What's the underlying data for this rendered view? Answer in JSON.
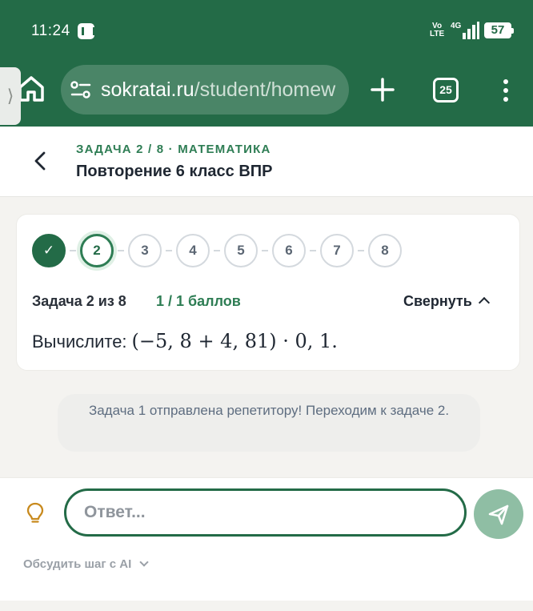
{
  "status_bar": {
    "time": "11:24",
    "volte": "Vo\nLTE",
    "network": "4G",
    "battery": "57"
  },
  "browser": {
    "url_domain": "sokratai.ru",
    "url_path": "/student/homew",
    "tab_count": "25"
  },
  "header": {
    "breadcrumb": "ЗАДАЧА 2 / 8 · МАТЕМАТИКА",
    "title": "Повторение 6 класс ВПР"
  },
  "task": {
    "steps": [
      {
        "label": "✓",
        "state": "done"
      },
      {
        "label": "2",
        "state": "current"
      },
      {
        "label": "3",
        "state": "pending"
      },
      {
        "label": "4",
        "state": "pending"
      },
      {
        "label": "5",
        "state": "pending"
      },
      {
        "label": "6",
        "state": "pending"
      },
      {
        "label": "7",
        "state": "pending"
      },
      {
        "label": "8",
        "state": "pending"
      }
    ],
    "label": "Задача 2 из 8",
    "score": "1 / 1 баллов",
    "collapse_label": "Свернуть",
    "question_prefix": "Вычислите:",
    "question_expr": "(−5, 8 + 4, 81) · 0, 1."
  },
  "info_message": "Задача 1 отправлена репетитору! Переходим к задаче 2.",
  "answer": {
    "placeholder": "Ответ...",
    "discuss_label": "Обсудить шаг с AI"
  },
  "colors": {
    "brand": "#236b47",
    "accent": "#2e7d54",
    "send_button": "#8fbea4",
    "hint_icon": "#c88a1e"
  }
}
